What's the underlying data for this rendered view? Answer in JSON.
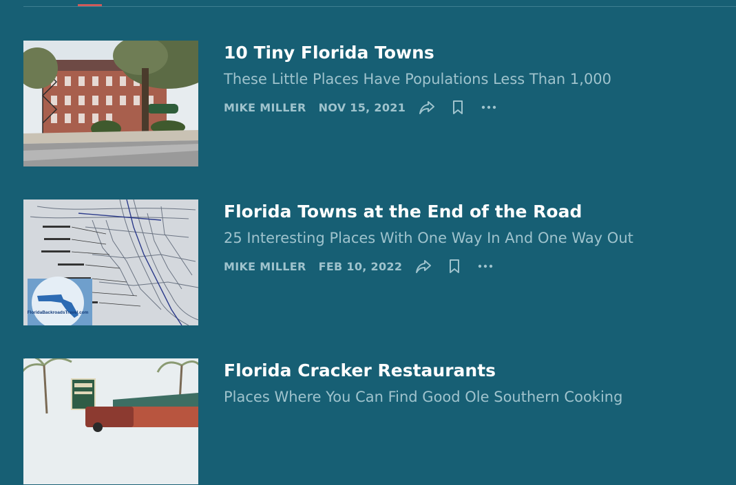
{
  "posts": [
    {
      "title": "10 Tiny Florida Towns",
      "subtitle": "These Little Places Have Populations Less Than 1,000",
      "author": "MIKE MILLER",
      "date": "NOV 15, 2021",
      "thumbnail": "brick-hotel-photo"
    },
    {
      "title": "Florida Towns at the End of the Road",
      "subtitle": "25 Interesting Places With One Way In And One Way Out",
      "author": "MIKE MILLER",
      "date": "FEB 10, 2022",
      "thumbnail": "florida-map-photo",
      "thumbnail_caption": "FloridaBackroadsTravel.com"
    },
    {
      "title": "Florida Cracker Restaurants",
      "subtitle": "Places Where You Can Find Good Ole Southern Cooking",
      "thumbnail": "restaurant-sign-photo"
    }
  ],
  "colors": {
    "background": "#175f74",
    "title": "#ffffff",
    "muted": "#9fc3cd",
    "tab_indicator": "#d05a5a"
  },
  "icons": [
    "share-icon",
    "bookmark-icon",
    "more-icon"
  ]
}
